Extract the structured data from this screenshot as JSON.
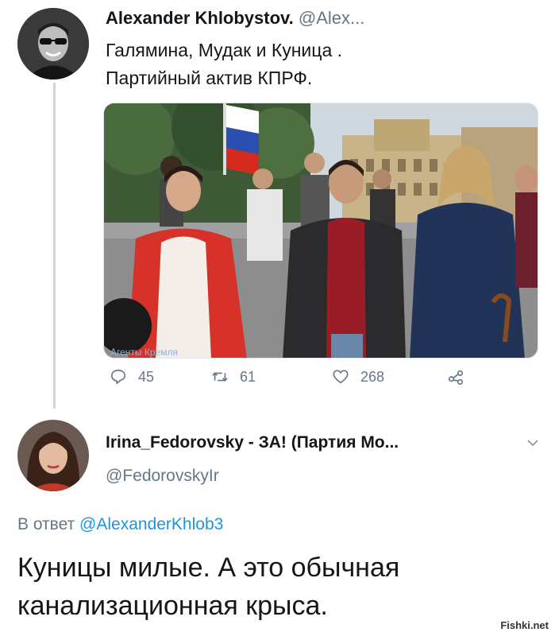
{
  "tweet1": {
    "author_name": "Alexander Khlobystov.",
    "author_handle": "@Alex...",
    "text_lines": [
      "Галямина, Мудак и Куница .",
      "Партийный актив КПРФ."
    ],
    "photo_watermark": "Агенты Кремля",
    "actions": {
      "reply_count": "45",
      "retweet_count": "61",
      "like_count": "268"
    }
  },
  "tweet2": {
    "author_name": "Irina_Fedorovsky - ЗА! (Партия Мо...",
    "author_handle": "@FedorovskyIr",
    "reply_prefix": "В ответ",
    "reply_mention": "@AlexanderKhlob3",
    "text_lines": [
      "Куницы милые. А это обычная",
      "канализационная крыса."
    ]
  },
  "site_watermark": "Fishki.net",
  "colors": {
    "text": "#14171a",
    "secondary": "#657786",
    "link": "#1b95e0",
    "thread_line": "#ccd6dd"
  }
}
